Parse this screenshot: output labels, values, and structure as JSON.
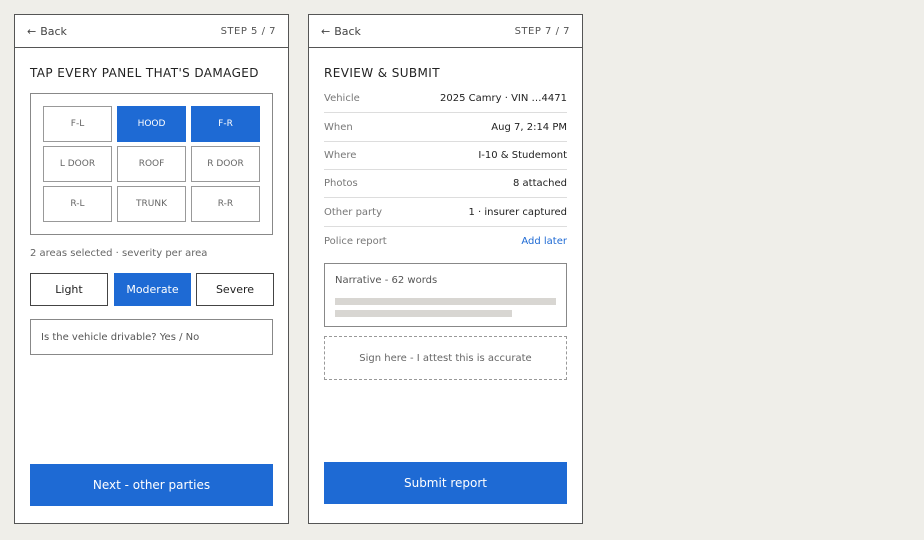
{
  "screen1": {
    "back_label": "Back",
    "step": "STEP 5 / 7",
    "title": "TAP EVERY PANEL THAT'S DAMAGED",
    "panels": [
      {
        "label": "F-L",
        "selected": false
      },
      {
        "label": "HOOD",
        "selected": true
      },
      {
        "label": "F-R",
        "selected": true
      },
      {
        "label": "L DOOR",
        "selected": false
      },
      {
        "label": "ROOF",
        "selected": false
      },
      {
        "label": "R DOOR",
        "selected": false
      },
      {
        "label": "R-L",
        "selected": false
      },
      {
        "label": "TRUNK",
        "selected": false
      },
      {
        "label": "R-R",
        "selected": false
      }
    ],
    "hint": "2 areas selected · severity per area",
    "severity": [
      {
        "label": "Light",
        "selected": false
      },
      {
        "label": "Moderate",
        "selected": true
      },
      {
        "label": "Severe",
        "selected": false
      }
    ],
    "drivable_prompt": "Is the vehicle drivable? Yes / No",
    "next_label": "Next - other parties"
  },
  "screen2": {
    "back_label": "Back",
    "step": "STEP 7 / 7",
    "title": "REVIEW & SUBMIT",
    "rows": [
      {
        "label": "Vehicle",
        "value": "2025 Camry · VIN …4471"
      },
      {
        "label": "When",
        "value": "Aug 7, 2:14 PM"
      },
      {
        "label": "Where",
        "value": "I-10 & Studemont"
      },
      {
        "label": "Photos",
        "value": "8 attached"
      },
      {
        "label": "Other party",
        "value": "1 · insurer captured"
      },
      {
        "label": "Police report",
        "value": "Add later"
      }
    ],
    "narrative_label": "Narrative - 62 words",
    "sign_prompt": "Sign here - I attest this is accurate",
    "submit_label": "Submit report"
  },
  "colors": {
    "accent": "#1e6ad4",
    "background": "#efeee9"
  },
  "icons": {
    "back": "arrow-left-icon"
  }
}
